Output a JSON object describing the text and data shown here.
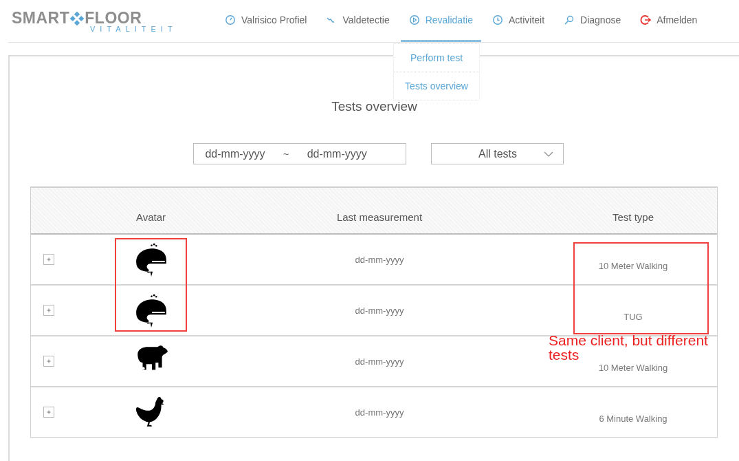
{
  "logo": {
    "word_left": "SMART",
    "word_right": "FLOOR",
    "tagline": "VITALITEIT"
  },
  "nav": [
    {
      "label": "Valrisico Profiel",
      "kind": "gauge",
      "selected": false
    },
    {
      "label": "Valdetectie",
      "kind": "zigzag",
      "selected": false
    },
    {
      "label": "Revalidatie",
      "kind": "play",
      "selected": true
    },
    {
      "label": "Activiteit",
      "kind": "clock",
      "selected": false
    },
    {
      "label": "Diagnose",
      "kind": "search",
      "selected": false
    },
    {
      "label": "Afmelden",
      "kind": "logout",
      "selected": false
    }
  ],
  "submenu": [
    {
      "label": "Perform test"
    },
    {
      "label": "Tests overview"
    }
  ],
  "title": "Tests overview",
  "date_filter": {
    "from_placeholder": "dd-mm-yyyy",
    "separator": "~",
    "to_placeholder": "dd-mm-yyyy"
  },
  "test_select": {
    "value": "All tests"
  },
  "table": {
    "columns": [
      "Avatar",
      "Last measurement",
      "Test type"
    ],
    "rows": [
      {
        "kind": "whale",
        "last_measurement": "dd-mm-yyyy",
        "test_type": "10 Meter Walking"
      },
      {
        "kind": "whale",
        "last_measurement": "dd-mm-yyyy",
        "test_type": "TUG"
      },
      {
        "kind": "bear",
        "last_measurement": "dd-mm-yyyy",
        "test_type": "10 Meter Walking"
      },
      {
        "kind": "chicken",
        "last_measurement": "dd-mm-yyyy",
        "test_type": "6 Minute Walking"
      }
    ]
  },
  "annotation": {
    "note": "Same client, but different tests"
  }
}
